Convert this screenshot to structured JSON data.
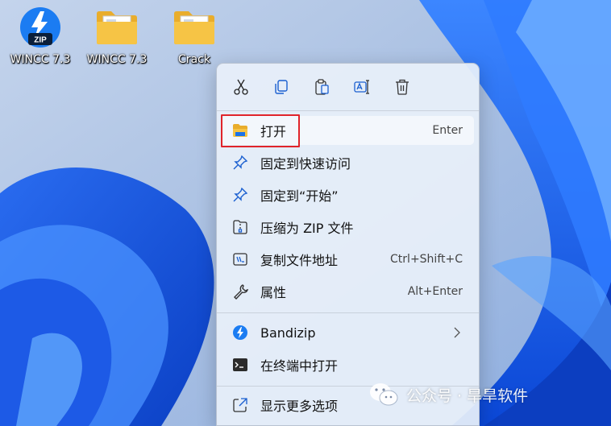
{
  "desktop": {
    "icons": [
      {
        "label": "WINCC 7.3",
        "icon": "zip-archive-icon",
        "badge": "ZIP"
      },
      {
        "label": "WINCC 7.3",
        "icon": "folder-icon"
      },
      {
        "label": "Crack",
        "icon": "folder-icon"
      }
    ]
  },
  "context_menu": {
    "quick_actions": [
      {
        "name": "cut",
        "icon": "scissors-icon"
      },
      {
        "name": "copy",
        "icon": "copy-icon"
      },
      {
        "name": "paste",
        "icon": "clipboard-icon"
      },
      {
        "name": "rename",
        "icon": "rename-icon"
      },
      {
        "name": "delete",
        "icon": "trash-icon"
      }
    ],
    "items": [
      {
        "label": "打开",
        "shortcut": "Enter",
        "icon": "folder-icon",
        "highlighted": true
      },
      {
        "label": "固定到快速访问",
        "shortcut": "",
        "icon": "pin-icon"
      },
      {
        "label": "固定到“开始”",
        "shortcut": "",
        "icon": "pin-icon"
      },
      {
        "label": "压缩为 ZIP 文件",
        "shortcut": "",
        "icon": "zip-folder-icon"
      },
      {
        "label": "复制文件地址",
        "shortcut": "Ctrl+Shift+C",
        "icon": "path-icon"
      },
      {
        "label": "属性",
        "shortcut": "Alt+Enter",
        "icon": "wrench-icon"
      },
      {
        "label": "Bandizip",
        "shortcut": "",
        "icon": "bandizip-icon",
        "has_submenu": true
      },
      {
        "label": "在终端中打开",
        "shortcut": "",
        "icon": "terminal-icon"
      },
      {
        "label": "显示更多选项",
        "shortcut": "",
        "icon": "more-options-icon"
      }
    ]
  },
  "watermark": {
    "text": "公众号 · 旱旱软件",
    "icon": "wechat-icon"
  },
  "colors": {
    "accent": "#1a73e8",
    "highlight_box": "#e0242a",
    "folder": "#f6c445"
  }
}
